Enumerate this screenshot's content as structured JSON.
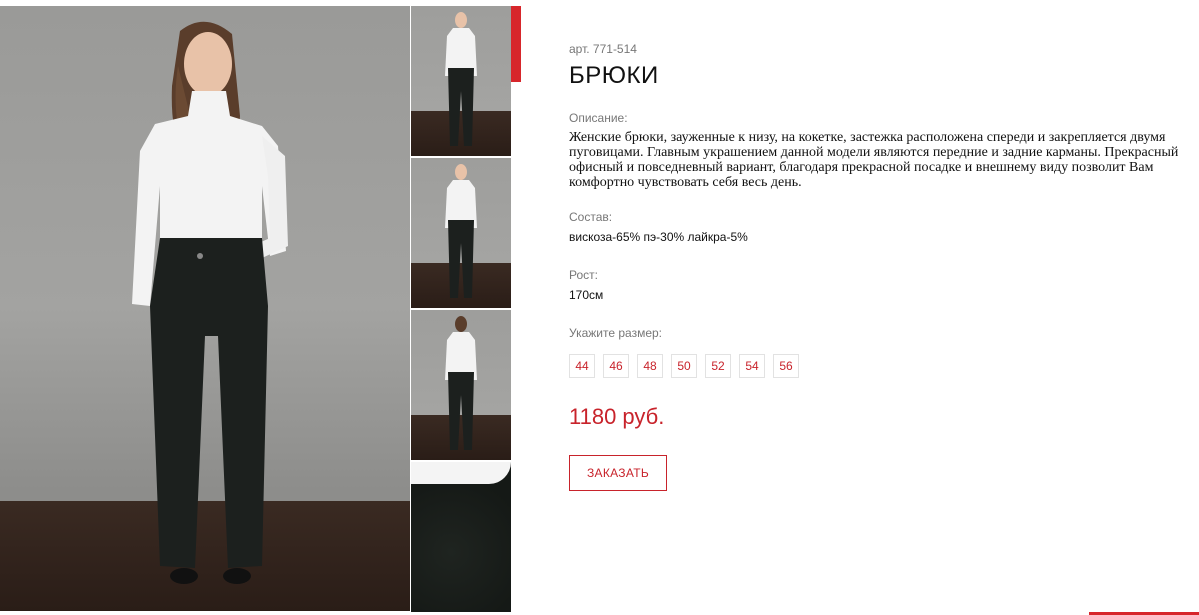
{
  "gallery": {
    "main_image_alt": "",
    "thumbnails": [
      "front",
      "front-pocket",
      "back",
      "closeup"
    ]
  },
  "product": {
    "article": "арт. 771-514",
    "title": "БРЮКИ",
    "description_label": "Описание:",
    "description": "Женские брюки, зауженные к низу, на кокетке, застежка расположена спереди и закрепляется двумя пуговицами. Главным украшением данной модели являются передние и задние карманы. Прекрасный офисный и повседневный вариант, благодаря прекрасной посадке и внешнему виду позволит Вам комфортно чувствовать себя весь день.",
    "composition_label": "Состав:",
    "composition": "вискоза-65% пэ-30% лайкра-5%",
    "height_label": "Рост:",
    "height": "170см",
    "size_label": "Укажите размер:",
    "sizes": [
      "44",
      "46",
      "48",
      "50",
      "52",
      "54",
      "56"
    ],
    "price": "1180 руб.",
    "order_button": "ЗАКАЗАТЬ"
  },
  "colors": {
    "accent": "#c8232b",
    "accent_bar": "#d7262b"
  }
}
